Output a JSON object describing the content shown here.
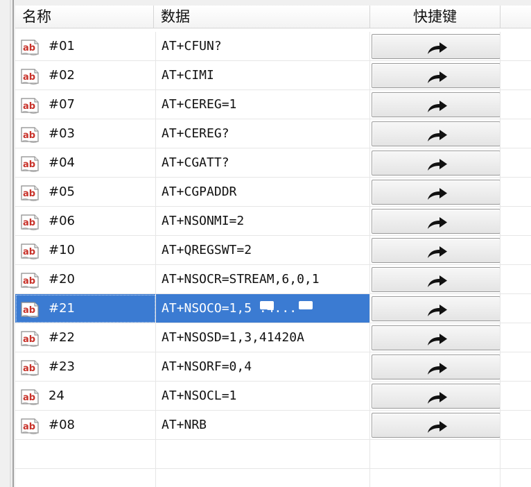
{
  "header": {
    "name_col": "名称",
    "data_col": "数据",
    "shortcut_col": "快捷键"
  },
  "rows": [
    {
      "name": "#01",
      "data": "AT+CFUN?"
    },
    {
      "name": "#02",
      "data": "AT+CIMI"
    },
    {
      "name": "#07",
      "data": "AT+CEREG=1"
    },
    {
      "name": "#03",
      "data": "AT+CEREG?"
    },
    {
      "name": "#04",
      "data": "AT+CGATT?"
    },
    {
      "name": "#05",
      "data": "AT+CGPADDR"
    },
    {
      "name": "#06",
      "data": "AT+NSONMI=2"
    },
    {
      "name": "#10",
      "data": "AT+QREGSWT=2"
    },
    {
      "name": "#20",
      "data": "AT+NSOCR=STREAM,6,0,1"
    },
    {
      "name": "#21",
      "data": "AT+NSOCO=1,5         .4...",
      "selected": true
    },
    {
      "name": "#22",
      "data": "AT+NSOSD=1,3,41420A"
    },
    {
      "name": "#23",
      "data": "AT+NSORF=0,4"
    },
    {
      "name": "24",
      "data": "AT+NSOCL=1"
    },
    {
      "name": "#08",
      "data": "AT+NRB"
    }
  ],
  "icons": {
    "row_icon": "ab-text-icon",
    "send_icon": "curved-arrow-icon"
  },
  "colors": {
    "selection": "#3b7bd2",
    "icon_red": "#c8322a"
  }
}
